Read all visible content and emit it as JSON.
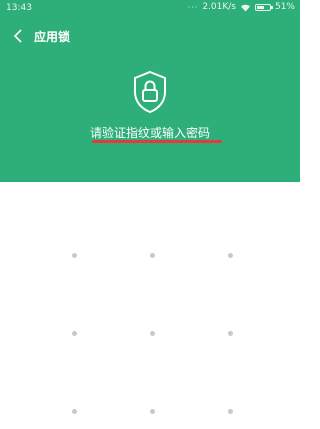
{
  "status_bar": {
    "time": "13:43",
    "network_speed": "2.01K/s",
    "battery": "51%",
    "icons": [
      "more-dots-icon",
      "signal-icon",
      "wifi-icon",
      "battery-icon"
    ]
  },
  "header": {
    "back_icon": "back-chevron-icon",
    "title": "应用锁"
  },
  "lock": {
    "icon": "shield-lock-icon",
    "prompt": "请验证指纹或输入密码"
  },
  "pattern": {
    "rows": 3,
    "cols": 3
  },
  "colors": {
    "accent": "#2eae79",
    "underline": "#e23b3b",
    "dot": "#c9c9c9"
  }
}
